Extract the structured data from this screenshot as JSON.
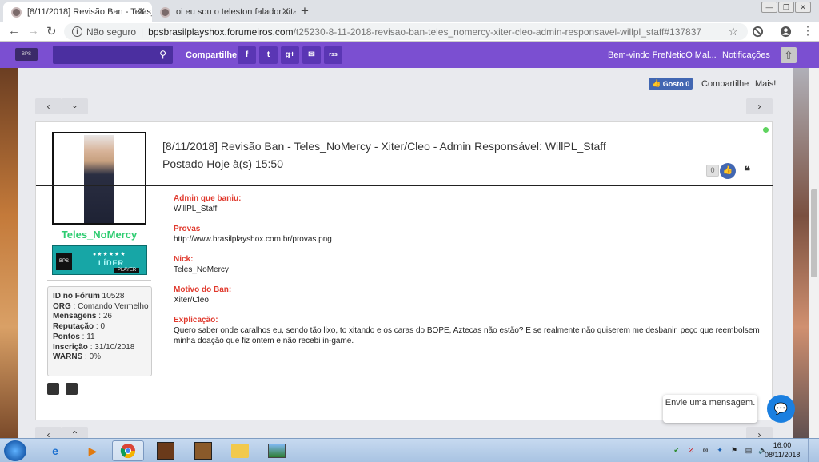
{
  "browser": {
    "tabs": [
      {
        "title": "[8/11/2018] Revisão Ban - Teles_",
        "active": true
      },
      {
        "title": "oi eu sou o teleston falador xitad",
        "active": false
      }
    ],
    "new_tab": "+",
    "security_label": "Não seguro",
    "url_host": "bpsbrasilplayshox.forumeiros.com",
    "url_path": "/t25230-8-11-2018-revisao-ban-teles_nomercy-xiter-cleo-admin-responsavel-willpl_staff#137837"
  },
  "forumbar": {
    "logo": "BPS",
    "share_label": "Compartilhe :",
    "share_buttons": [
      "f",
      "t",
      "g+",
      "✉",
      "rss"
    ],
    "welcome": "Bem-vindo FreNeticO Mal...",
    "notifications": "Notificações"
  },
  "social": {
    "like_label": "Gosto",
    "like_count": "0",
    "share": "Compartilhe",
    "more": "Mais!"
  },
  "post": {
    "author": "Teles_NoMercy",
    "rank": {
      "label": "LÍDER",
      "tag": "PLAYER",
      "logo": "BPS"
    },
    "stats": [
      {
        "key": "ID no Fórum",
        "value": "10528"
      },
      {
        "key": "ORG",
        "value": "Comando Vermelho"
      },
      {
        "key": "Mensagens",
        "value": "26"
      },
      {
        "key": "Reputação",
        "value": "0"
      },
      {
        "key": "Pontos",
        "value": "11"
      },
      {
        "key": "Inscrição",
        "value": "31/10/2018"
      },
      {
        "key": "WARNS",
        "value": "0%"
      }
    ],
    "title": "[8/11/2018] Revisão Ban - Teles_NoMercy - Xiter/Cleo - Admin Responsável: WillPL_Staff",
    "posted": "Postado Hoje à(s) 15:50",
    "likes": "0",
    "body": [
      {
        "label": "Admin que baniu:",
        "value": "WillPL_Staff"
      },
      {
        "label": "Provas",
        "value": "http://www.brasilplayshox.com.br/provas.png"
      },
      {
        "label": "Nick:",
        "value": "Teles_NoMercy"
      },
      {
        "label": "Motivo do Ban:",
        "value": "Xiter/Cleo"
      },
      {
        "label": "Explicação:",
        "value": "Quero saber onde caralhos eu, sendo tão lixo, to xitando e os caras do BOPE, Aztecas não estão? E se realmente não quiserem me desbanir, peço que reembolsem minha doação que fiz ontem e não recebi in-game."
      }
    ]
  },
  "chat": {
    "text": "Envie uma mensagem."
  },
  "taskbar": {
    "time": "16:00",
    "date": "08/11/2018"
  },
  "colors": {
    "accent": "#7b4fd1",
    "online": "#5fd35f",
    "label_red": "#e03a2e",
    "username": "#2ecc71"
  }
}
